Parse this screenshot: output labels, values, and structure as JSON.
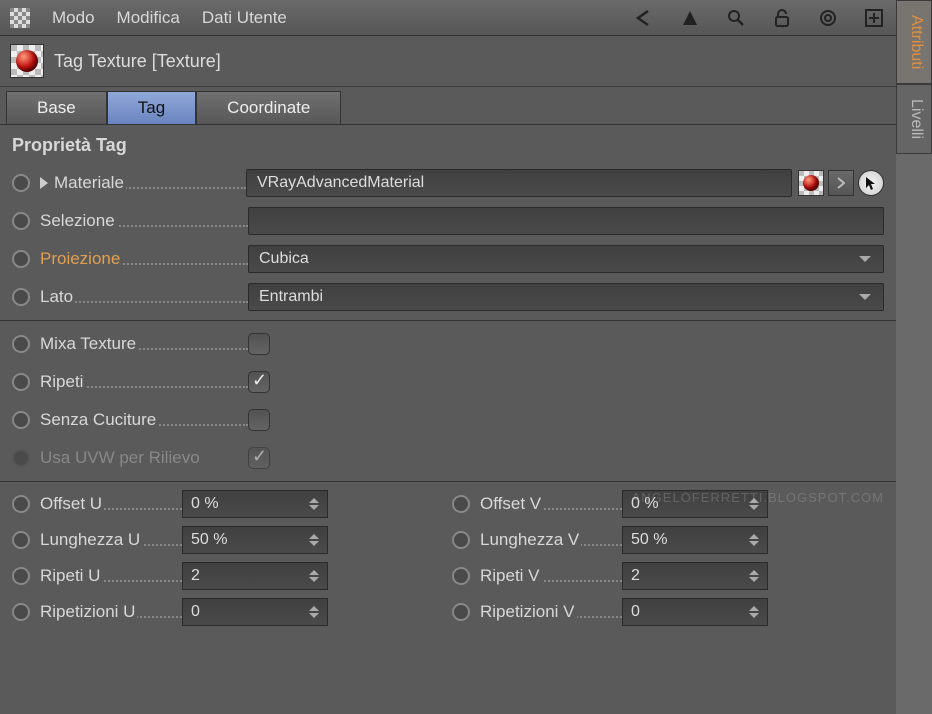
{
  "menu": {
    "modo": "Modo",
    "modifica": "Modifica",
    "dati_utente": "Dati Utente"
  },
  "side_tabs": {
    "attributi": "Attributi",
    "livelli": "Livelli"
  },
  "header": {
    "title": "Tag Texture [Texture]"
  },
  "tabs": {
    "base": "Base",
    "tag": "Tag",
    "coordinate": "Coordinate"
  },
  "section_title": "Proprietà Tag",
  "props": {
    "materiale_label": "Materiale",
    "materiale_value": "VRayAdvancedMaterial",
    "selezione_label": "Selezione",
    "selezione_value": "",
    "proiezione_label": "Proiezione",
    "proiezione_value": "Cubica",
    "lato_label": "Lato",
    "lato_value": "Entrambi",
    "mixa_label": "Mixa Texture",
    "ripeti_label": "Ripeti",
    "senza_cuciture_label": "Senza Cuciture",
    "usa_uvw_label": "Usa UVW per Rilievo"
  },
  "numeric": {
    "offset_u_label": "Offset U",
    "offset_u_value": "0 %",
    "offset_v_label": "Offset V",
    "offset_v_value": "0 %",
    "lunghezza_u_label": "Lunghezza U",
    "lunghezza_u_value": "50 %",
    "lunghezza_v_label": "Lunghezza V",
    "lunghezza_v_value": "50 %",
    "ripeti_u_label": "Ripeti U",
    "ripeti_u_value": "2",
    "ripeti_v_label": "Ripeti V",
    "ripeti_v_value": "2",
    "ripetizioni_u_label": "Ripetizioni U",
    "ripetizioni_u_value": "0",
    "ripetizioni_v_label": "Ripetizioni V",
    "ripetizioni_v_value": "0"
  },
  "watermark": "ANGELOFERRETTI.BLOGSPOT.COM"
}
